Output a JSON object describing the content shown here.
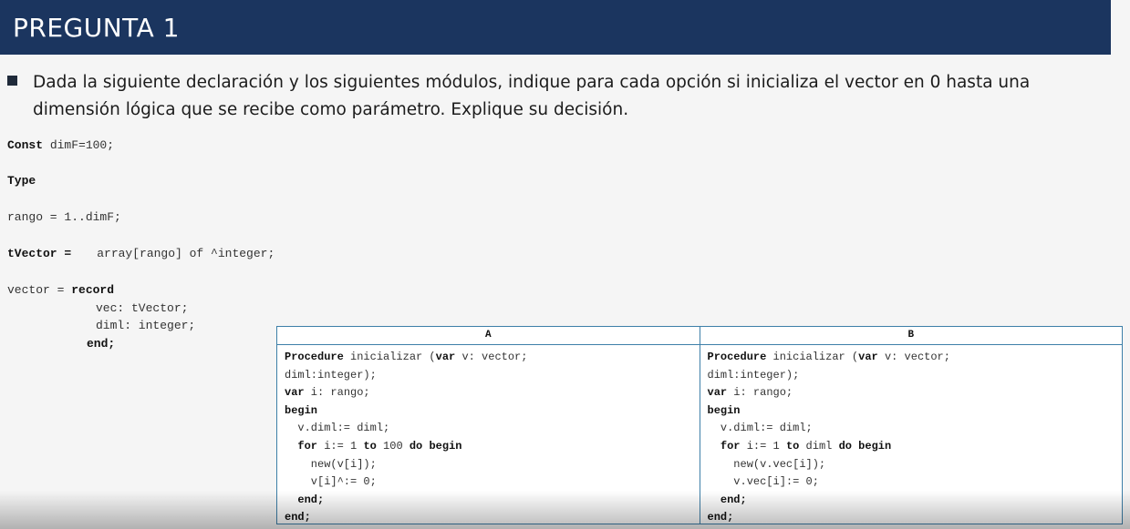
{
  "header": {
    "title": "PREGUNTA 1"
  },
  "question": {
    "text": "Dada la siguiente declaración y los siguientes módulos, indique para cada opción si inicializa el vector en 0 hasta una dimensión lógica que se recibe como parámetro. Explique su decisión."
  },
  "declaration": {
    "const_kw": "Const",
    "const_rest": " dimF=100;",
    "type_kw": "Type",
    "rango_line": "rango = 1..dimF;",
    "tvector_kw": "tVector =",
    "tvector_rest": "array[rango] of ^integer;",
    "vector_pre": "vector = ",
    "vector_kw": "record",
    "vec_line": "vec: tVector;",
    "diml_line": "diml: integer;",
    "end_kw": "end;"
  },
  "options": {
    "a": {
      "header": "A",
      "l1_kw": "Procedure",
      "l1_rest": " inicializar (",
      "l1_kw2": "var",
      "l1_rest2": " v: vector;",
      "l2": "diml:integer);",
      "l3_kw": "var",
      "l3_rest": " i: rango;",
      "l4_kw": "begin",
      "l5": "  v.diml:= diml;",
      "l6_pre": "  ",
      "l6_kw": "for",
      "l6_mid": " i:= 1 ",
      "l6_kw2": "to",
      "l6_mid2": " 100 ",
      "l6_kw3": "do begin",
      "l7": "    new(v[i]);",
      "l8": "    v[i]^:= 0;",
      "l9_pre": "  ",
      "l9_kw": "end;",
      "l10_kw": "end;"
    },
    "b": {
      "header": "B",
      "l1_kw": "Procedure",
      "l1_rest": " inicializar (",
      "l1_kw2": "var",
      "l1_rest2": " v: vector;",
      "l2": "diml:integer);",
      "l3_kw": "var",
      "l3_rest": " i: rango;",
      "l4_kw": "begin",
      "l5": "  v.diml:= diml;",
      "l6_pre": "  ",
      "l6_kw": "for",
      "l6_mid": " i:= 1 ",
      "l6_kw2": "to",
      "l6_mid2": " diml ",
      "l6_kw3": "do begin",
      "l7": "    new(v.vec[i]);",
      "l8": "    v.vec[i]:= 0;",
      "l9_pre": "  ",
      "l9_kw": "end;",
      "l10_kw": "end;"
    }
  },
  "colors": {
    "header_bg": "#1b355f",
    "table_border": "#3d7fa8"
  }
}
